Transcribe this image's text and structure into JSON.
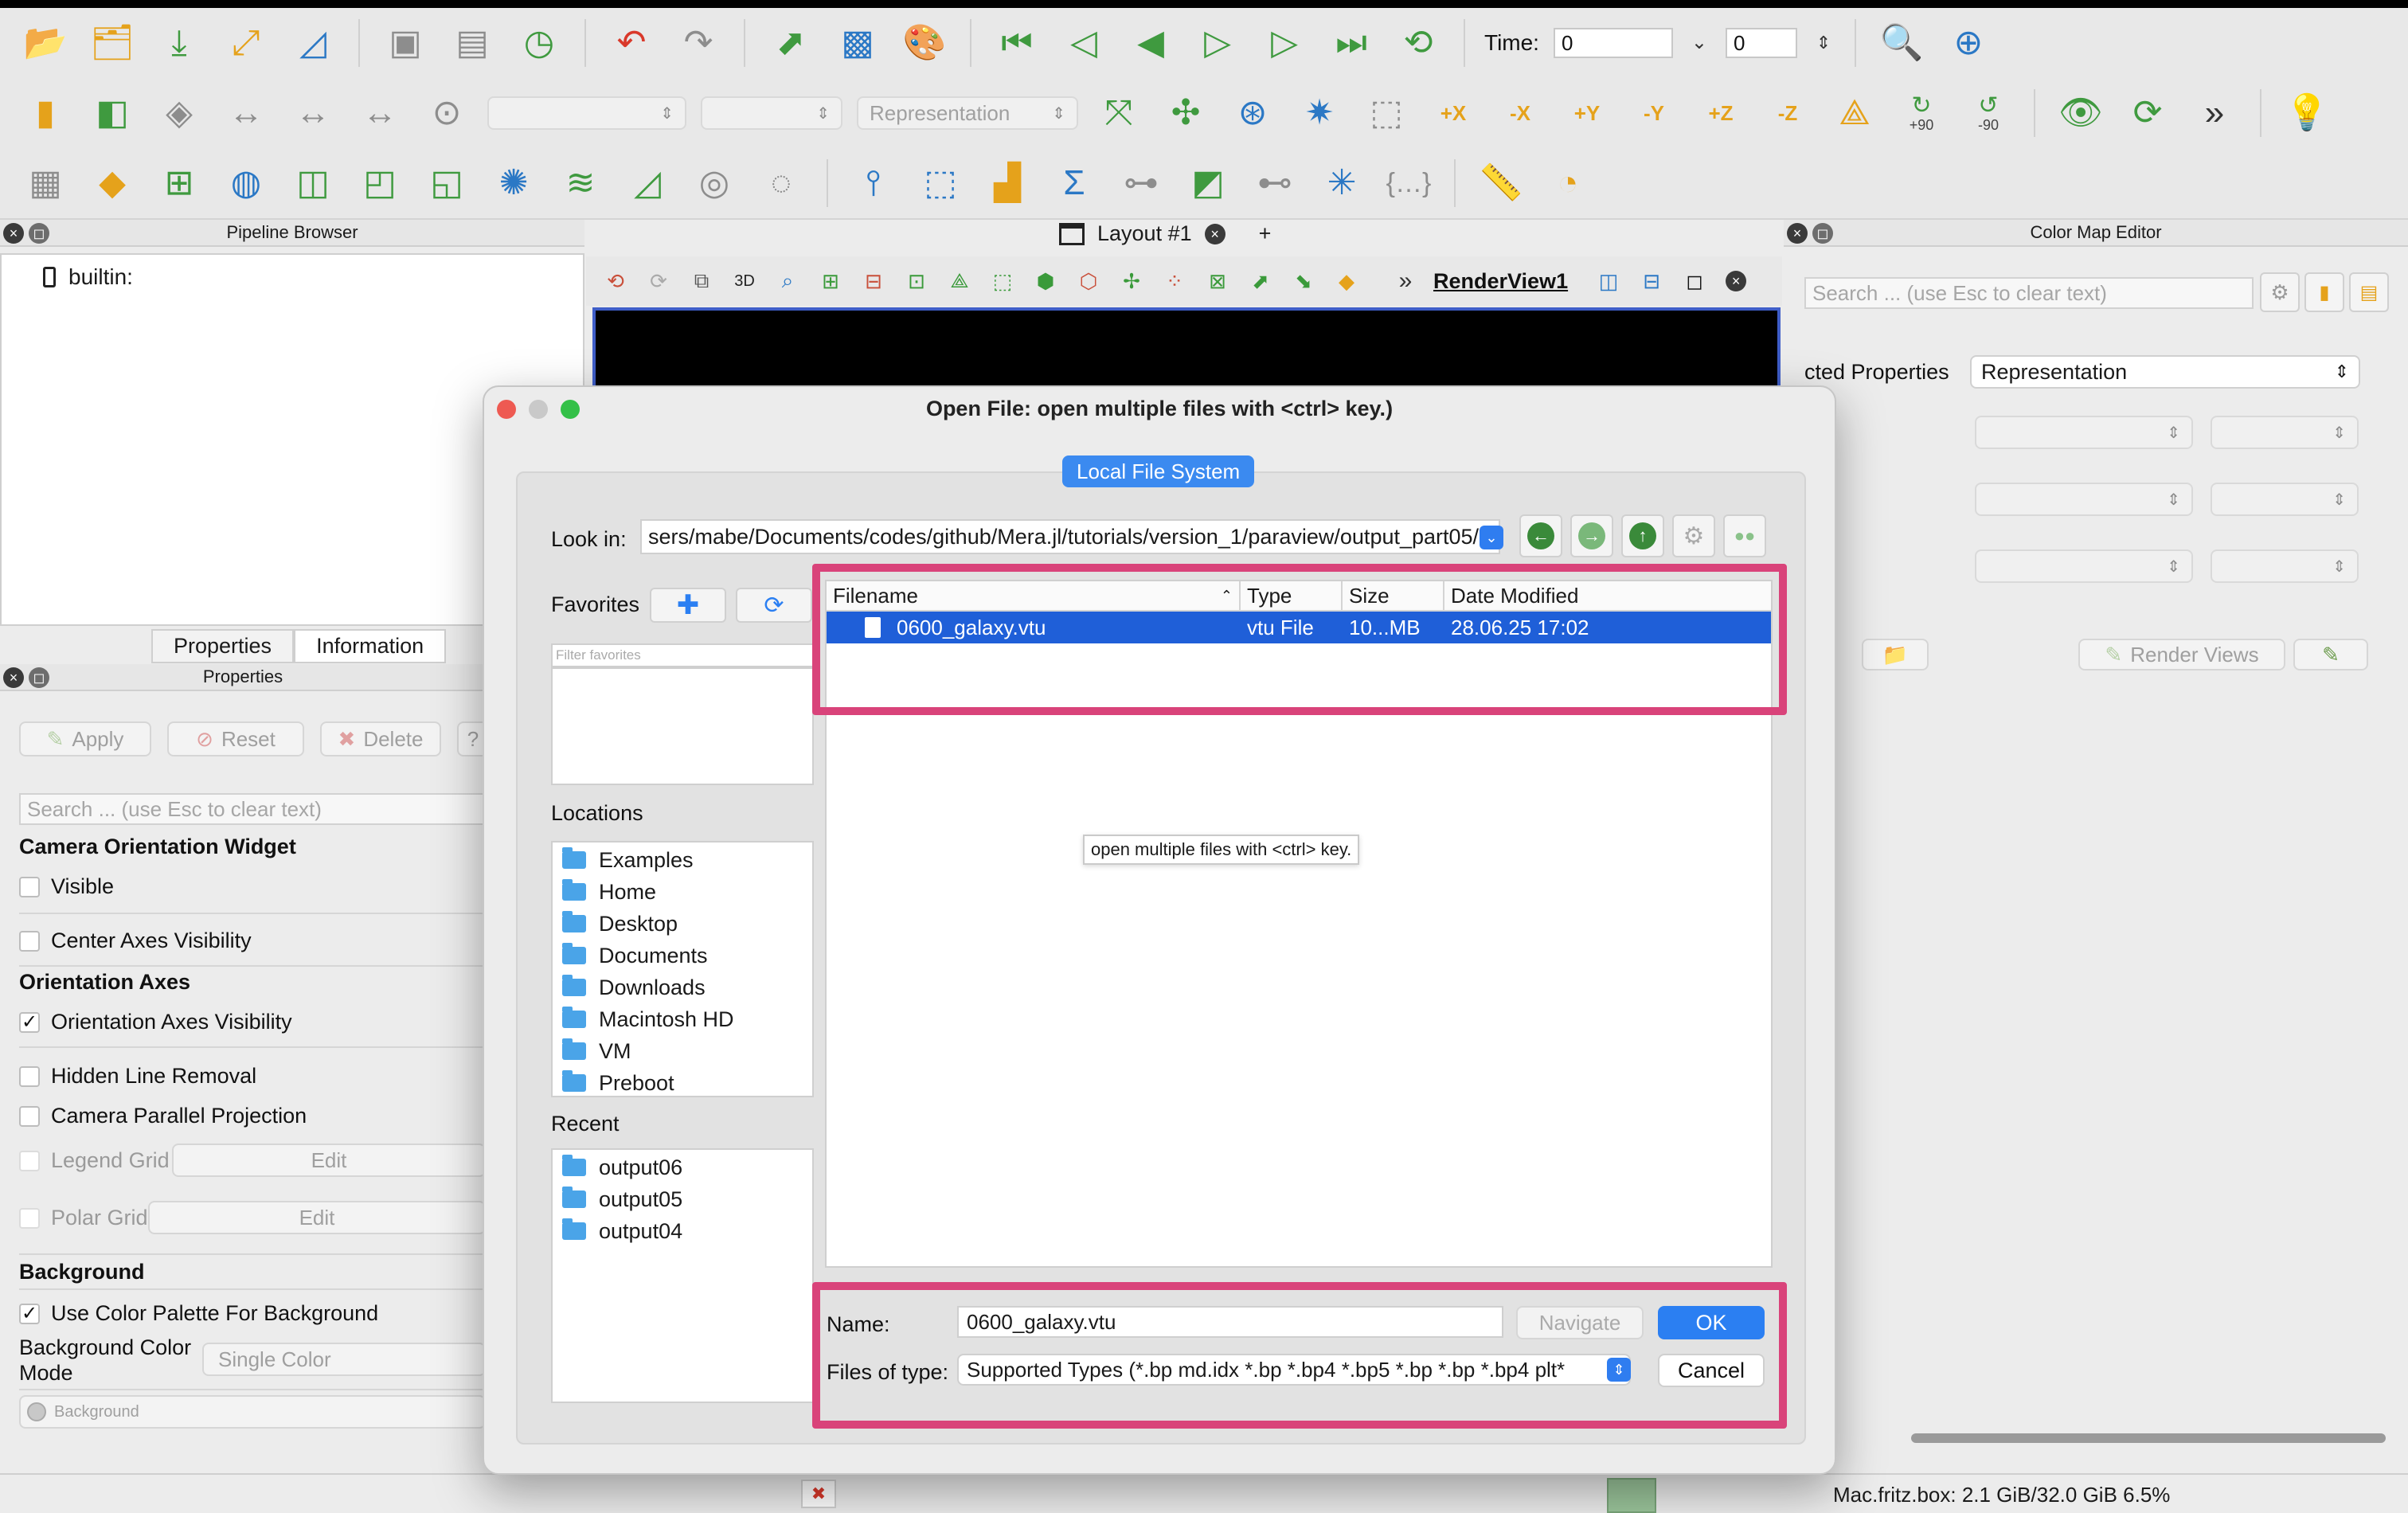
{
  "toolbar": {
    "time_label": "Time:",
    "time_value": "0",
    "time_step_value": "0",
    "representation_placeholder": "Representation",
    "rotate_plus90": "+90",
    "rotate_minus90": "-90",
    "camera_axes": [
      "+X",
      "-X",
      "+Y",
      "-Y",
      "+Z",
      "-Z"
    ]
  },
  "pipeline": {
    "title": "Pipeline Browser",
    "source_name": "builtin:"
  },
  "properties_panel": {
    "tabs": [
      "Properties",
      "Information"
    ],
    "title": "Properties",
    "apply_label": "Apply",
    "reset_label": "Reset",
    "delete_label": "Delete",
    "help_label": "?",
    "search_placeholder": "Search ... (use Esc to clear text)",
    "camera_orientation_widget_title": "Camera Orientation Widget",
    "visible_label": "Visible",
    "center_axes_label": "Center Axes Visibility",
    "orientation_axes_title": "Orientation Axes",
    "orientation_axes_visibility_label": "Orientation Axes Visibility",
    "hidden_line_removal_label": "Hidden Line Removal",
    "camera_parallel_projection_label": "Camera Parallel Projection",
    "legend_grid_label": "Legend Grid",
    "legend_grid_edit": "Edit",
    "polar_grid_label": "Polar Grid",
    "polar_grid_edit": "Edit",
    "background_title": "Background",
    "use_color_palette_label": "Use Color Palette For Background",
    "background_color_mode_label_1": "Background Color",
    "background_color_mode_label_2": "Mode",
    "background_color_mode_value": "Single Color",
    "background_swatch_label": "Background"
  },
  "layout": {
    "tab_label": "Layout #1",
    "add_tab": "+",
    "view_3d": "3D",
    "render_view_name": "RenderView1",
    "more": "»"
  },
  "color_map_editor": {
    "title": "Color Map Editor",
    "search_placeholder": "Search ... (use Esc to clear text)",
    "selected_properties_label": "cted Properties",
    "representation_value": "Representation",
    "render_views_label": "Render Views"
  },
  "dialog": {
    "title": "Open File:  open multiple files with <ctrl> key.)",
    "local_fs_label": "Local File System",
    "look_in_label": "Look in:",
    "look_in_path": "sers/mabe/Documents/codes/github/Mera.jl/tutorials/version_1/paraview/output_part05/",
    "favorites_label": "Favorites",
    "favorites_filter_placeholder": "Filter favorites",
    "locations_label": "Locations",
    "locations": [
      "Examples",
      "Home",
      "Desktop",
      "Documents",
      "Downloads",
      "Macintosh HD",
      "VM",
      "Preboot"
    ],
    "recent_label": "Recent",
    "recent": [
      "output06",
      "output05",
      "output04"
    ],
    "columns": {
      "filename": "Filename",
      "type": "Type",
      "size": "Size",
      "date": "Date Modified"
    },
    "files": [
      {
        "name": "0600_galaxy.vtu",
        "type": "vtu File",
        "size": "10...MB",
        "date": "28.06.25 17:02"
      }
    ],
    "tooltip": "open multiple files with <ctrl> key.",
    "name_label": "Name:",
    "name_value": "0600_galaxy.vtu",
    "navigate_label": "Navigate",
    "ok_label": "OK",
    "files_of_type_label": "Files of type:",
    "files_of_type_value": "Supported Types (*.bp md.idx *.bp *.bp4 *.bp5 *.bp *.bp *.bp4 plt*",
    "cancel_label": "Cancel"
  },
  "status": {
    "memory": "Mac.fritz.box: 2.1 GiB/32.0 GiB 6.5%"
  },
  "colors": {
    "highlight": "#d9437a",
    "selection": "#1f5fd8",
    "accent": "#2b7ff2"
  }
}
